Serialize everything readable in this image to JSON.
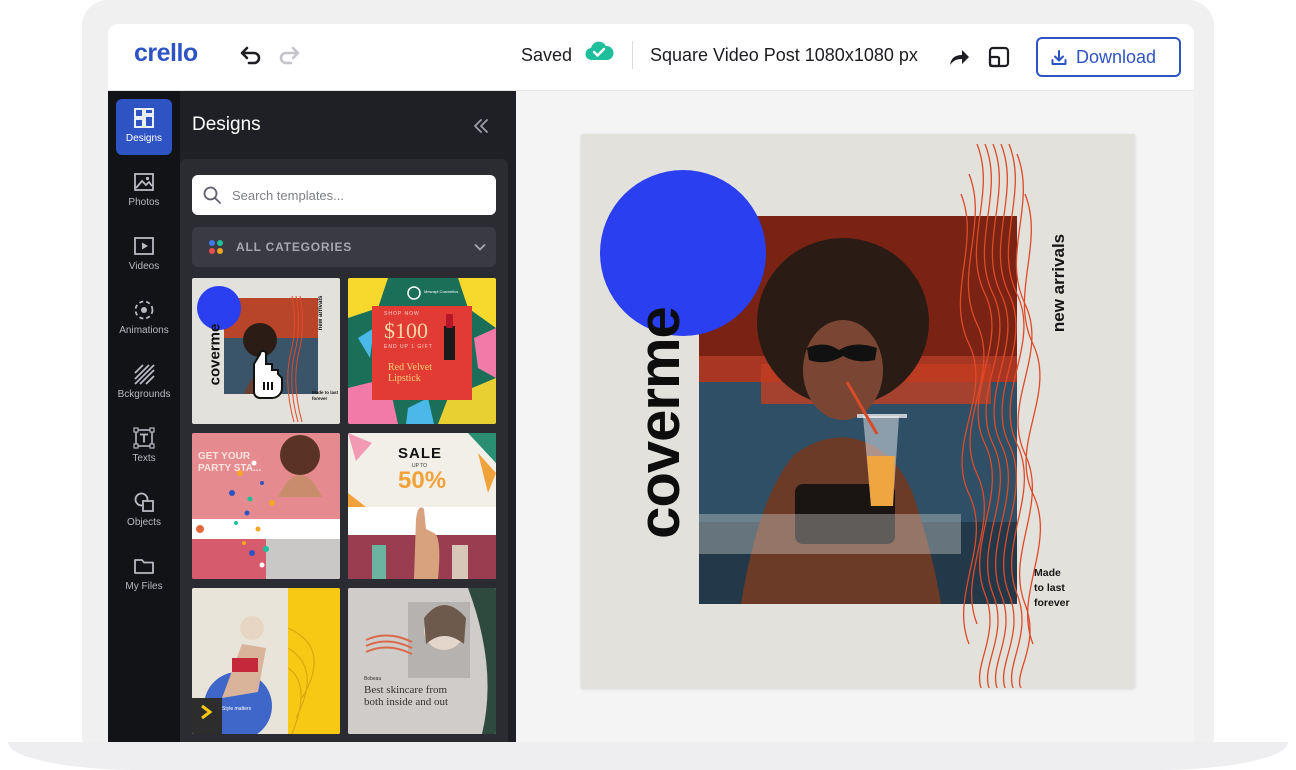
{
  "app": {
    "logo": "crello",
    "status": "Saved",
    "document_title": "Square Video Post 1080x1080 px",
    "download_label": "Download",
    "accent_color": "#2e54c4",
    "saved_color": "#1fbf9c"
  },
  "toolbar": {
    "undo_icon": "undo-icon",
    "redo_icon": "redo-icon",
    "share_icon": "share-arrow-icon",
    "resize_icon": "resize-icon"
  },
  "rail": {
    "items": [
      {
        "label": "Designs",
        "icon": "designs-grid-icon",
        "active": true
      },
      {
        "label": "Photos",
        "icon": "image-icon",
        "active": false
      },
      {
        "label": "Videos",
        "icon": "play-icon",
        "active": false
      },
      {
        "label": "Animations",
        "icon": "animation-icon",
        "active": false
      },
      {
        "label": "Bckgrounds",
        "icon": "stripes-icon",
        "active": false
      },
      {
        "label": "Texts",
        "icon": "text-icon",
        "active": false
      },
      {
        "label": "Objects",
        "icon": "shapes-icon",
        "active": false
      },
      {
        "label": "My Files",
        "icon": "folder-icon",
        "active": false
      }
    ]
  },
  "panel": {
    "title": "Designs",
    "search_placeholder": "Search templates...",
    "categories_label": "ALL CATEGORIES",
    "thumbs": [
      {
        "caption": "coverme",
        "sub": "new arrivals",
        "foot": "Made to last forever"
      },
      {
        "price": "$100",
        "top": "SHOP NOW",
        "sub": "END UP 1 GIFT",
        "title": "Red Velvet Lipstick",
        "brand": "Mesrapt Cosmetics"
      },
      {
        "text": "GET YOUR PARTY STA..."
      },
      {
        "text": "SALE",
        "sub": "UP TO",
        "value": "50%"
      },
      {
        "text": "Style matters"
      },
      {
        "text": "Best skincare from both inside and out",
        "brand": "Bobeau"
      }
    ]
  },
  "artboard": {
    "brand": "coverme",
    "tagline": "new arrivals",
    "footer": "Made\nto last\nforever",
    "circle_color": "#2a3ff0",
    "background": "#e3e1dc"
  }
}
